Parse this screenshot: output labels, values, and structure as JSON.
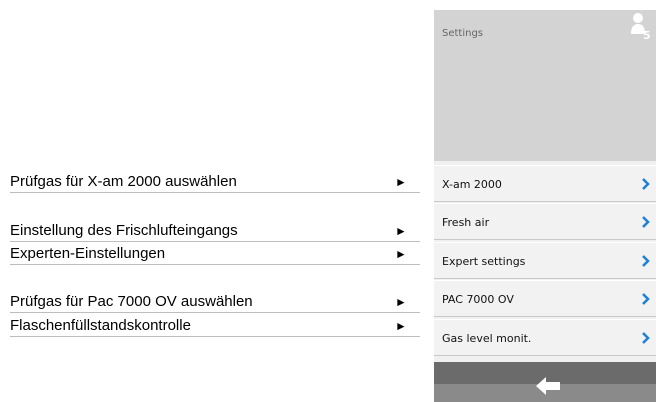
{
  "annotations": [
    {
      "label": "Prüfgas für X-am 2000 auswählen",
      "arrow": "►"
    },
    {
      "label": "Einstellung des Frischlufteingangs",
      "arrow": "►"
    },
    {
      "label": "Experten-Einstellungen",
      "arrow": "►"
    },
    {
      "label": "Prüfgas für Pac 7000 OV auswählen",
      "arrow": "►"
    },
    {
      "label": "Flaschenfüllstandskontrolle",
      "arrow": "►"
    }
  ],
  "screen": {
    "title": "Settings",
    "user_level": "5",
    "menu": [
      {
        "label": "X-am 2000"
      },
      {
        "label": "Fresh air"
      },
      {
        "label": "Expert settings"
      },
      {
        "label": "PAC 7000 OV"
      },
      {
        "label": "Gas level monit."
      }
    ]
  },
  "colors": {
    "accent": "#1e7fd6",
    "header": "#d3d3d3",
    "footer": "#6b6b6b"
  },
  "icons": {
    "user": "user-level-icon",
    "chevron": "chevron-right-icon",
    "back": "back-arrow-icon"
  }
}
